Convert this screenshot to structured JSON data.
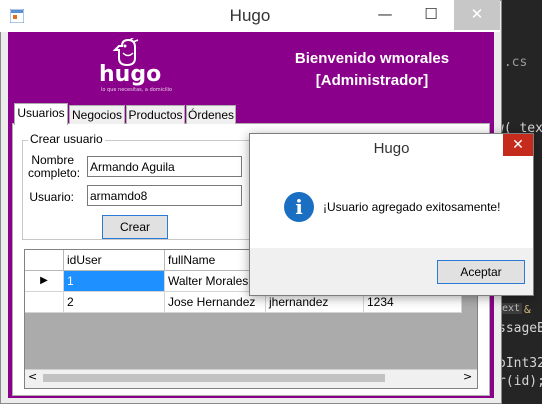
{
  "ide": {
    "lines": [
      "w( text",
      ").cs",
      "ext",
      "&",
      "ssageB",
      "oInt32",
      "r(id);"
    ]
  },
  "window": {
    "title": "Hugo",
    "controls": {
      "minimize": "—",
      "maximize": "☐",
      "close": "✕"
    }
  },
  "header": {
    "logo_text": "hugo",
    "tagline": "lo que necesitas, a domicilio",
    "welcome_line1": "Bienvenido wmorales",
    "welcome_line2": "[Administrador]"
  },
  "tabs": [
    {
      "label": "Usuarios"
    },
    {
      "label": "Negocios"
    },
    {
      "label": "Productos"
    },
    {
      "label": "Órdenes"
    }
  ],
  "form": {
    "group_title": "Crear usuario",
    "name_label_1": "Nombre",
    "name_label_2": "completo:",
    "name_value": "Armando Aguila",
    "user_label": "Usuario:",
    "user_value": "armamdo8",
    "create_button": "Crear"
  },
  "grid": {
    "columns": [
      "idUser",
      "fullName"
    ],
    "rows": [
      {
        "marker": "▶",
        "idUser": "1",
        "fullName": "Walter Morales"
      },
      {
        "marker": "",
        "idUser": "2",
        "fullName": "Jose Hernandez",
        "extra1": "jhernandez",
        "extra2": "1234"
      }
    ],
    "scroll_left": "<",
    "scroll_right": ">"
  },
  "dialog": {
    "title": "Hugo",
    "close": "✕",
    "icon": "i",
    "message": "¡Usuario agregado exitosamente!",
    "ok_button": "Aceptar"
  },
  "colors": {
    "brand": "#8b008b",
    "selection": "#1e90ff",
    "info_icon": "#1a6fc2",
    "dialog_close": "#c42b1c"
  }
}
